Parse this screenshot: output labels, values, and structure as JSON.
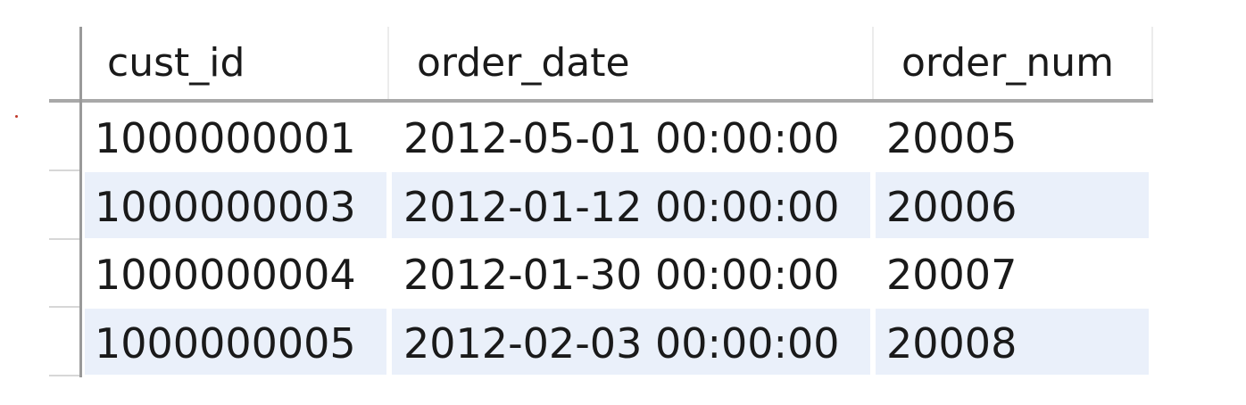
{
  "table": {
    "columns": [
      "cust_id",
      "order_date",
      "order_num"
    ],
    "rows": [
      [
        "1000000001",
        "2012-05-01 00:00:00",
        "20005"
      ],
      [
        "1000000003",
        "2012-01-12 00:00:00",
        "20006"
      ],
      [
        "1000000004",
        "2012-01-30 00:00:00",
        "20007"
      ],
      [
        "1000000005",
        "2012-02-03 00:00:00",
        "20008"
      ]
    ]
  },
  "colors": {
    "alt_row": "#eaf0fa",
    "row": "#ffffff",
    "header_rule": "#a8a8a8"
  }
}
